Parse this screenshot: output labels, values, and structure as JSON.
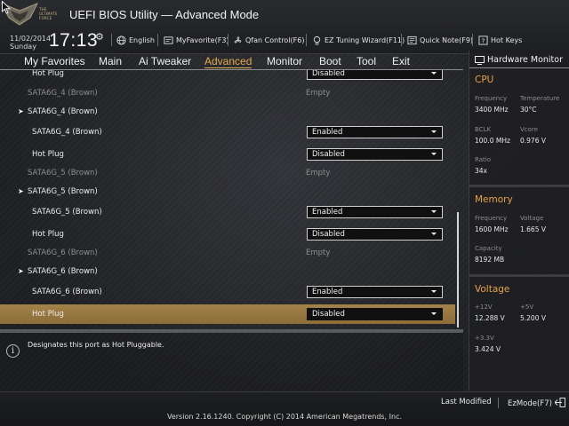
{
  "header": {
    "logo_text": "THE ULTIMATE FORCE",
    "title": "UEFI BIOS Utility — Advanced Mode",
    "date": "11/02/2014",
    "day": "Sunday",
    "time": "17:13",
    "items": [
      {
        "label": "English",
        "icon": "globe-icon"
      },
      {
        "label": "MyFavorite(F3)",
        "icon": "favorite-icon"
      },
      {
        "label": "Qfan Control(F6)",
        "icon": "fan-icon"
      },
      {
        "label": "EZ Tuning Wizard(F11)",
        "icon": "lightbulb-icon"
      },
      {
        "label": "Quick Note(F9)",
        "icon": "note-icon"
      },
      {
        "label": "Hot Keys",
        "icon": "help-icon"
      }
    ]
  },
  "tabs": [
    {
      "label": "My Favorites"
    },
    {
      "label": "Main"
    },
    {
      "label": "Ai Tweaker"
    },
    {
      "label": "Advanced",
      "active": true
    },
    {
      "label": "Monitor"
    },
    {
      "label": "Boot"
    },
    {
      "label": "Tool"
    },
    {
      "label": "Exit"
    }
  ],
  "rows": [
    {
      "label": "Hot Plug",
      "value": "Disabled"
    },
    {
      "label": "SATA6G_4 (Brown)",
      "value": "Empty"
    },
    {
      "label": "SATA6G_4 (Brown)"
    },
    {
      "label": "SATA6G_4 (Brown)",
      "value": "Enabled"
    },
    {
      "label": "Hot Plug",
      "value": "Disabled"
    },
    {
      "label": "SATA6G_5 (Brown)",
      "value": "Empty"
    },
    {
      "label": "SATA6G_5 (Brown)"
    },
    {
      "label": "SATA6G_5 (Brown)",
      "value": "Enabled"
    },
    {
      "label": "Hot Plug",
      "value": "Disabled"
    },
    {
      "label": "SATA6G_6 (Brown)",
      "value": "Empty"
    },
    {
      "label": "SATA6G_6 (Brown)"
    },
    {
      "label": "SATA6G_6 (Brown)",
      "value": "Enabled"
    },
    {
      "label": "Hot Plug",
      "value": "Disabled"
    }
  ],
  "help_text": "Designates this port as Hot Pluggable.",
  "hardware_monitor": {
    "title": "Hardware Monitor",
    "cpu": {
      "title": "CPU",
      "frequency_label": "Frequency",
      "frequency": "3400 MHz",
      "temperature_label": "Temperature",
      "temperature": "30°C",
      "bclk_label": "BCLK",
      "bclk": "100.0 MHz",
      "vcore_label": "Vcore",
      "vcore": "0.976 V",
      "ratio_label": "Ratio",
      "ratio": "34x"
    },
    "memory": {
      "title": "Memory",
      "frequency_label": "Frequency",
      "frequency": "1600 MHz",
      "voltage_label": "Voltage",
      "voltage": "1.665 V",
      "capacity_label": "Capacity",
      "capacity": "8192 MB"
    },
    "voltage": {
      "title": "Voltage",
      "v12_label": "+12V",
      "v12": "12.288 V",
      "v5_label": "+5V",
      "v5": "5.200 V",
      "v33_label": "+3.3V",
      "v33": "3.424 V"
    }
  },
  "footer": {
    "last_modified": "Last Modified",
    "ezmode": "EzMode(F7)",
    "copyright": "Version 2.16.1240. Copyright (C) 2014 American Megatrends, Inc."
  },
  "colors": {
    "accent": "#e4a94f",
    "selected_row": "#9c7b42",
    "background": "#232427"
  }
}
